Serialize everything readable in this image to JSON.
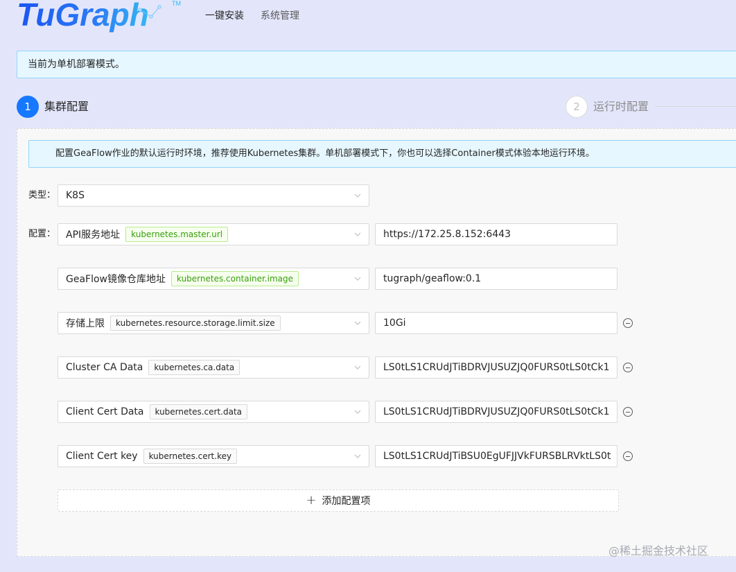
{
  "brand": {
    "logo_text": "TuGraph",
    "trademark": "TM"
  },
  "nav": {
    "install": "一键安装",
    "manage": "系统管理"
  },
  "mode_banner": "当前为单机部署模式。",
  "steps": [
    {
      "number": "1",
      "label": "集群配置",
      "status": "active"
    },
    {
      "number": "2",
      "label": "运行时配置",
      "status": "wait"
    }
  ],
  "info_alert": "配置GeaFlow作业的默认运行时环境，推荐使用Kubernetes集群。单机部署模式下，你也可以选择Container模式体验本地运行环境。",
  "form": {
    "type_label": "类型：",
    "type_value": "K8S",
    "config_label": "配置：",
    "rows": [
      {
        "label": "API服务地址",
        "key": "kubernetes.master.url",
        "value": "https://172.25.8.152:6443"
      },
      {
        "label": "GeaFlow镜像仓库地址",
        "key": "kubernetes.container.image",
        "value": "tugraph/geaflow:0.1"
      },
      {
        "label": "存储上限",
        "key": "kubernetes.resource.storage.limit.size",
        "value": "10Gi"
      },
      {
        "label": "Cluster CA Data",
        "key": "kubernetes.ca.data",
        "value": "LS0tLS1CRUdJTiBDRVJUSUZJQ0FURS0tLS0tCk1"
      },
      {
        "label": "Client Cert Data",
        "key": "kubernetes.cert.data",
        "value": "LS0tLS1CRUdJTiBDRVJUSUZJQ0FURS0tLS0tCk1"
      },
      {
        "label": "Client Cert key",
        "key": "kubernetes.cert.key",
        "value": "LS0tLS1CRUdJTiBSU0EgUFJJVkFURSBLRVktLS0t"
      }
    ],
    "add_button": "添加配置项"
  },
  "watermark": "@稀土掘金技术社区",
  "colors": {
    "primary": "#1677ff",
    "background": "#e3e6fb",
    "tag_green": "#389e0d"
  }
}
